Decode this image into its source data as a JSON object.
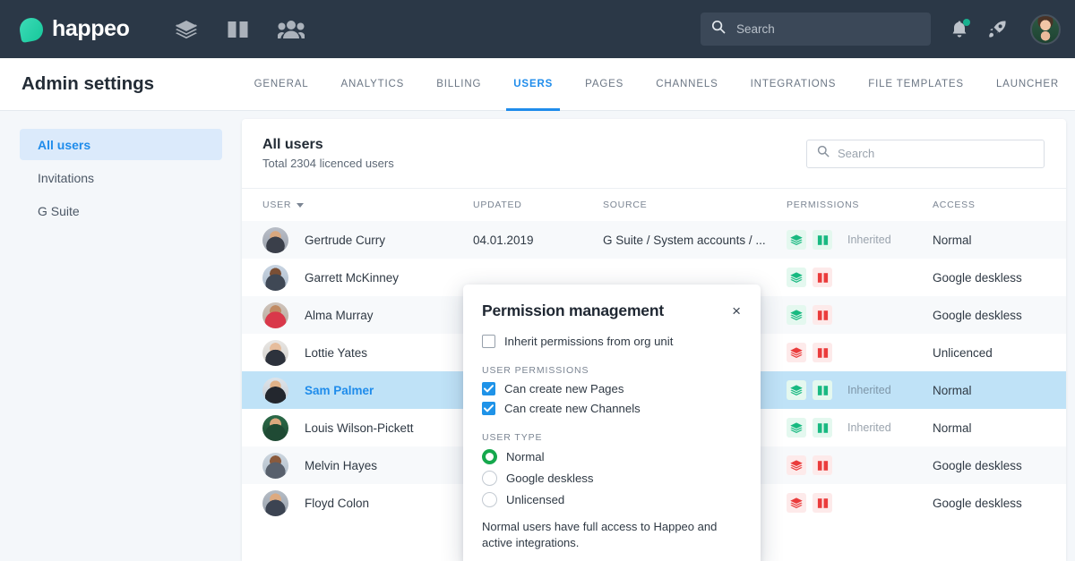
{
  "topbar": {
    "brand": "happeo",
    "brand_mark_color": "#16c79a",
    "icons": [
      {
        "name": "channels-icon"
      },
      {
        "name": "pages-book-icon"
      },
      {
        "name": "people-icon"
      }
    ],
    "search": {
      "placeholder": "Search",
      "value": ""
    },
    "notification_dot_color": "#15d3a5"
  },
  "subheader": {
    "title": "Admin settings",
    "tabs": [
      {
        "label": "GENERAL",
        "active": false
      },
      {
        "label": "ANALYTICS",
        "active": false
      },
      {
        "label": "BILLING",
        "active": false
      },
      {
        "label": "USERS",
        "active": true
      },
      {
        "label": "PAGES",
        "active": false
      },
      {
        "label": "CHANNELS",
        "active": false
      },
      {
        "label": "INTEGRATIONS",
        "active": false
      },
      {
        "label": "FILE TEMPLATES",
        "active": false
      },
      {
        "label": "LAUNCHER",
        "active": false
      }
    ],
    "active_color": "#1f8ceb"
  },
  "sidebar": {
    "items": [
      {
        "label": "All users",
        "active": true
      },
      {
        "label": "Invitations",
        "active": false
      },
      {
        "label": "G Suite",
        "active": false
      }
    ]
  },
  "card": {
    "title": "All users",
    "subtitle": "Total 2304 licenced users",
    "search": {
      "placeholder": "Search",
      "value": ""
    },
    "columns": [
      "USER",
      "UPDATED",
      "SOURCE",
      "PERMISSIONS",
      "ACCESS"
    ],
    "rows": [
      {
        "name": "Gertrude Curry",
        "updated": "04.01.2019",
        "source": "G Suite / System accounts / ...",
        "channels": "green",
        "pages": "green",
        "inherited": "Inherited",
        "access": "Normal",
        "selected": false
      },
      {
        "name": "Garrett McKinney",
        "updated": "",
        "source": "",
        "channels": "green",
        "pages": "red",
        "inherited": "",
        "access": "Google deskless",
        "selected": false
      },
      {
        "name": "Alma Murray",
        "updated": "",
        "source": "",
        "channels": "green",
        "pages": "red",
        "inherited": "",
        "access": "Google deskless",
        "selected": false
      },
      {
        "name": "Lottie Yates",
        "updated": "",
        "source": "",
        "channels": "red",
        "pages": "red",
        "inherited": "",
        "access": "Unlicenced",
        "selected": false
      },
      {
        "name": "Sam Palmer",
        "updated": "",
        "source": "",
        "channels": "green",
        "pages": "green",
        "inherited": "Inherited",
        "access": "Normal",
        "selected": true
      },
      {
        "name": "Louis Wilson-Pickett",
        "updated": "",
        "source": "",
        "channels": "green",
        "pages": "green",
        "inherited": "Inherited",
        "access": "Normal",
        "selected": false
      },
      {
        "name": "Melvin Hayes",
        "updated": "",
        "source": "",
        "channels": "red",
        "pages": "red",
        "inherited": "",
        "access": "Google deskless",
        "selected": false
      },
      {
        "name": "Floyd Colon",
        "updated": "",
        "source": "",
        "channels": "red",
        "pages": "red",
        "inherited": "",
        "access": "Google deskless",
        "selected": false
      }
    ],
    "selected_row_color": "#bfe2f7",
    "permission_green": "#18b981",
    "permission_red": "#ea3b3b"
  },
  "modal": {
    "title": "Permission management",
    "close_label": "×",
    "inherit": {
      "label": "Inherit permissions from org unit",
      "checked": false
    },
    "user_permissions_heading": "USER PERMISSIONS",
    "permissions": [
      {
        "label": "Can create new Pages",
        "checked": true
      },
      {
        "label": "Can create new Channels",
        "checked": true
      }
    ],
    "user_type_heading": "USER TYPE",
    "user_types": [
      {
        "label": "Normal",
        "selected": true
      },
      {
        "label": "Google deskless",
        "selected": false
      },
      {
        "label": "Unlicensed",
        "selected": false
      }
    ],
    "note": "Normal users have full access to Happeo and active integrations.",
    "checkbox_color": "#1f93e8",
    "radio_color": "#15a84d"
  }
}
